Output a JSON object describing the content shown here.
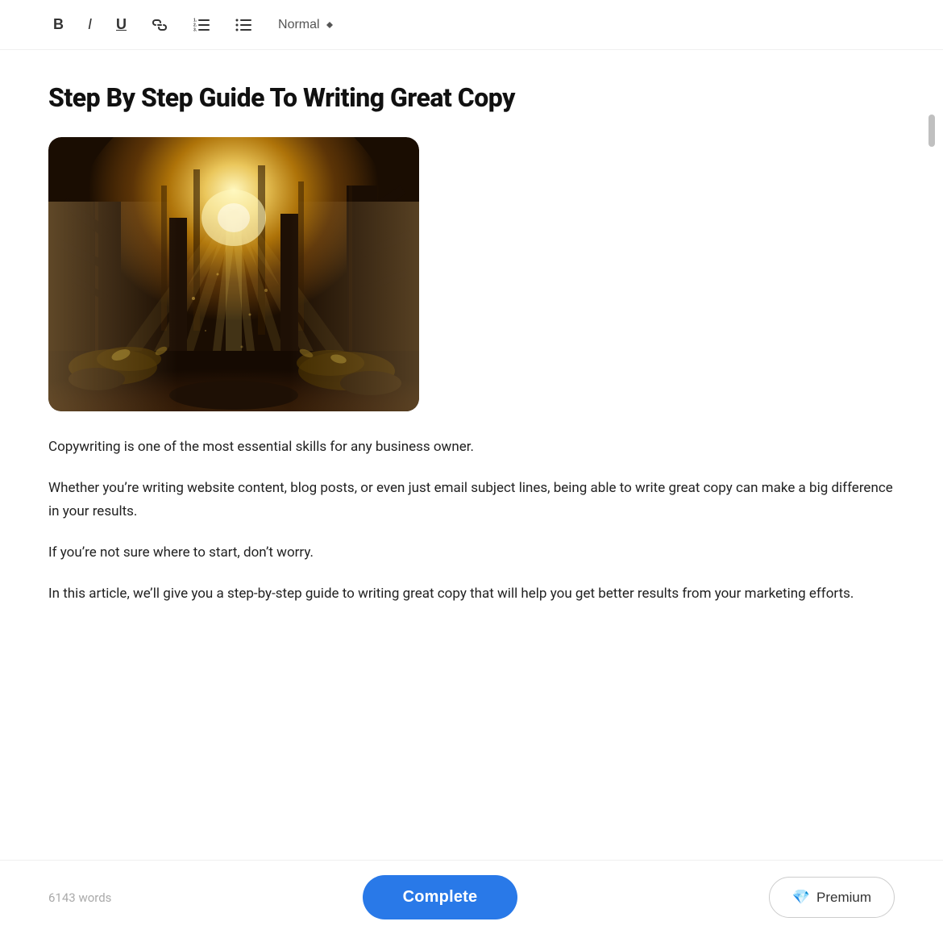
{
  "toolbar": {
    "bold_label": "B",
    "italic_label": "I",
    "underline_label": "U",
    "link_icon": "🔗",
    "ordered_list_icon": "≡",
    "unordered_list_icon": "☰",
    "dropdown_label": "Normal",
    "dropdown_arrow": "⬦"
  },
  "article": {
    "title": "Step By Step Guide To Writing Great Copy",
    "paragraph1": "Copywriting is one of the most essential skills for any business owner.",
    "paragraph2": "Whether you’re writing website content, blog posts, or even just email subject lines, being able to write great copy can make a big difference in your results.",
    "paragraph3": "If you’re not sure where to start, don’t worry.",
    "paragraph4": "In this article, we’ll give you a step-by-step guide to writing great copy that will help you get better results from your marketing efforts."
  },
  "bottom_bar": {
    "word_count": "6143 words",
    "complete_label": "Complete",
    "premium_label": "Premium",
    "diamond_icon": "💎"
  }
}
